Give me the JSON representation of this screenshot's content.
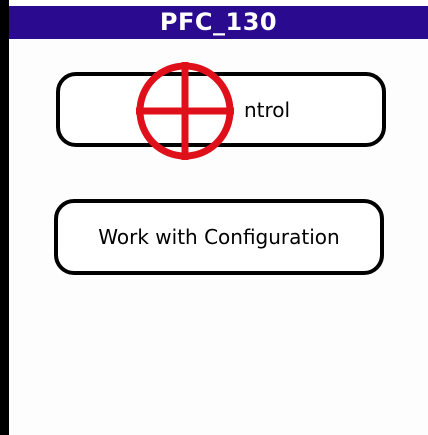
{
  "window": {
    "title": "PFC_130"
  },
  "buttons": {
    "control_label": "ntrol",
    "configuration_label": "Work with Configuration"
  },
  "overlay": {
    "marker_icon": "crosshair-icon",
    "marker_color": "#e0101a"
  },
  "colors": {
    "titlebar_bg": "#2a0a8f",
    "titlebar_text": "#ffffff",
    "border": "#000000"
  }
}
